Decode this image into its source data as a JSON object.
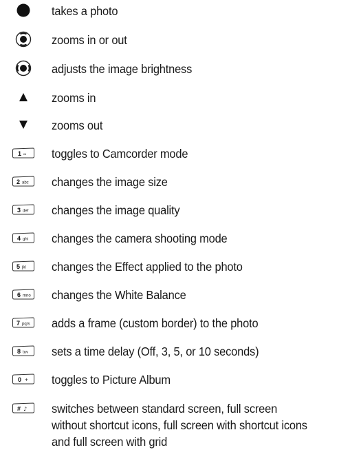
{
  "items": [
    {
      "icon": "solid-circle-button-icon",
      "text": "takes a photo"
    },
    {
      "icon": "navigation-key-up-down-icon",
      "text": "zooms in or out"
    },
    {
      "icon": "navigation-key-left-right-icon",
      "text": "adjusts the image brightness"
    },
    {
      "icon": "up-triangle-icon",
      "text": "zooms in"
    },
    {
      "icon": "down-triangle-icon",
      "text": "zooms out"
    },
    {
      "icon": "key-1-icon",
      "key_main": "1",
      "key_sub": "∞",
      "text": "toggles to Camcorder mode"
    },
    {
      "icon": "key-2-icon",
      "key_main": "2",
      "key_sub": "abc",
      "text": "changes the image size"
    },
    {
      "icon": "key-3-icon",
      "key_main": "3",
      "key_sub": "def",
      "text": "changes the image quality"
    },
    {
      "icon": "key-4-icon",
      "key_main": "4",
      "key_sub": "ghi",
      "text": "changes the camera shooting mode"
    },
    {
      "icon": "key-5-icon",
      "key_main": "5",
      "key_sub": "jkl",
      "text": "changes the Effect applied to the photo"
    },
    {
      "icon": "key-6-icon",
      "key_main": "6",
      "key_sub": "mno",
      "text": "changes the White Balance"
    },
    {
      "icon": "key-7-icon",
      "key_main": "7",
      "key_sub": "pqrs",
      "text": "adds a frame (custom border) to the photo"
    },
    {
      "icon": "key-8-icon",
      "key_main": "8",
      "key_sub": "tuv",
      "text": "sets a time delay (Off, 3, 5, or 10 seconds)"
    },
    {
      "icon": "key-0-icon",
      "key_main": "0",
      "key_sub": "+",
      "text": "toggles to Picture Album"
    },
    {
      "icon": "key-hash-icon",
      "key_main": "#",
      "key_sub": "♪",
      "text_lines": [
        "switches between standard screen, full screen",
        "without shortcut icons, full screen with shortcut icons",
        "and full screen with grid"
      ]
    }
  ]
}
